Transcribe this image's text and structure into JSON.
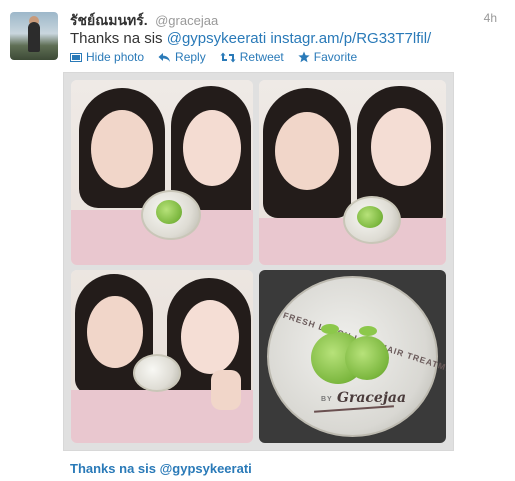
{
  "tweet": {
    "fullname": "รัชย์ณมนทร์.",
    "username": "@gracejaa",
    "time": "4h",
    "text_prefix": "Thanks na sis ",
    "mention": "@gypsykeerati",
    "link": "instagr.am/p/RG33T7lfil/",
    "actions": {
      "hide_photo": "Hide photo",
      "reply": "Reply",
      "retweet": "Retweet",
      "favorite": "Favorite"
    },
    "photo": {
      "jar_label": "FRESH LEECH LIME HAIR TREATMENT",
      "jar_brand": "Gracejaa",
      "jar_by": "BY"
    },
    "footer_text": "Thanks na sis @gypsykeerati"
  },
  "colors": {
    "link": "#2a7ab8",
    "text": "#333333",
    "muted": "#999999"
  }
}
